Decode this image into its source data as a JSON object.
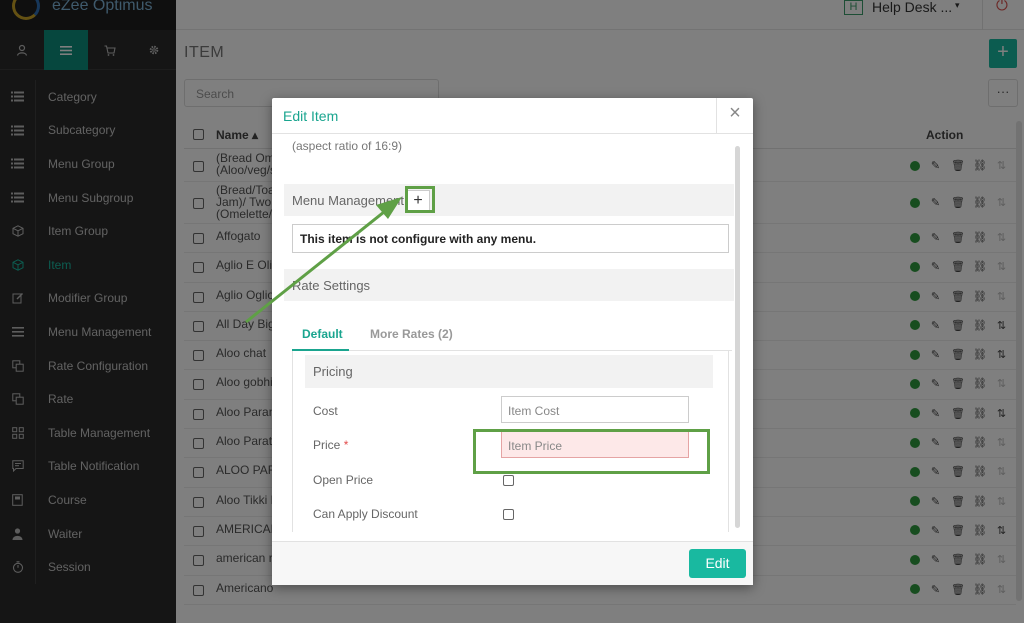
{
  "app": {
    "logo_text": "eZee Optimus",
    "user_badge": "H",
    "user_menu": "Help Desk ...",
    "caret": "▾"
  },
  "sidebar": {
    "tabs": [
      "user-icon",
      "list-icon",
      "cart-icon",
      "gear-icon"
    ],
    "items": [
      {
        "label": "Category",
        "icon": "list-icon"
      },
      {
        "label": "Subcategory",
        "icon": "list-icon"
      },
      {
        "label": "Menu Group",
        "icon": "list-icon"
      },
      {
        "label": "Menu Subgroup",
        "icon": "list-icon"
      },
      {
        "label": "Item Group",
        "icon": "cube-icon"
      },
      {
        "label": "Item",
        "icon": "cube-icon",
        "active": true
      },
      {
        "label": "Modifier Group",
        "icon": "edit-icon"
      },
      {
        "label": "Menu Management",
        "icon": "bars-icon"
      },
      {
        "label": "Rate Configuration",
        "icon": "copy-icon"
      },
      {
        "label": "Rate",
        "icon": "copy-icon"
      },
      {
        "label": "Table Management",
        "icon": "grid-icon"
      },
      {
        "label": "Table Notification",
        "icon": "message-icon"
      },
      {
        "label": "Course",
        "icon": "book-icon"
      },
      {
        "label": "Waiter",
        "icon": "person-icon"
      },
      {
        "label": "Session",
        "icon": "timer-icon"
      }
    ]
  },
  "main": {
    "title": "ITEM",
    "add_label": "+",
    "search_placeholder": "Search",
    "more_label": "···",
    "columns": {
      "name": "Name ▴",
      "action": "Action"
    },
    "rows": [
      {
        "name": "(Bread Om",
        "name2": "(Aloo/veg/s",
        "double": true,
        "reorder": false
      },
      {
        "name": "(Bread/Toa",
        "name2": "Jam)/ Two",
        "name3": "(Omelette/",
        "triple": true,
        "reorder": false
      },
      {
        "name": "Affogato",
        "reorder": false
      },
      {
        "name": "Aglio E Olio",
        "reorder": false
      },
      {
        "name": "Aglio Oglio",
        "reorder": false
      },
      {
        "name": "All Day Big",
        "reorder": true
      },
      {
        "name": "Aloo chat",
        "reorder": true
      },
      {
        "name": "Aloo gobhi",
        "reorder": false
      },
      {
        "name": "Aloo Paran",
        "reorder": true
      },
      {
        "name": "Aloo Parath",
        "reorder": false
      },
      {
        "name": "ALOO PAR",
        "reorder": false
      },
      {
        "name": "Aloo Tikki B",
        "reorder": false
      },
      {
        "name": "AMERICAN",
        "reorder": true
      },
      {
        "name": "american ra",
        "reorder": false
      },
      {
        "name": "Americano",
        "reorder": false
      }
    ]
  },
  "modal": {
    "title": "Edit Item",
    "close": "×",
    "ratio_text": "(aspect ratio of 16:9)",
    "menu_management": {
      "heading": "Menu Management",
      "add": "+",
      "message": "This item is not configure with any menu."
    },
    "rate_settings": {
      "heading": "Rate Settings",
      "tabs": [
        "Default",
        "More Rates (2)"
      ]
    },
    "pricing": {
      "heading": "Pricing",
      "cost_label": "Cost",
      "cost_placeholder": "Item Cost",
      "price_label": "Price",
      "required_mark": "*",
      "price_placeholder": "Item Price",
      "open_price_label": "Open Price",
      "discount_label": "Can Apply Discount"
    },
    "submit_label": "Edit"
  },
  "colors": {
    "accent": "#19b9a0",
    "sidebar_bg": "#2b2b2b",
    "annotation": "#5fa046",
    "status_active": "#2f9a3e",
    "error_bg": "#fde8e8"
  }
}
